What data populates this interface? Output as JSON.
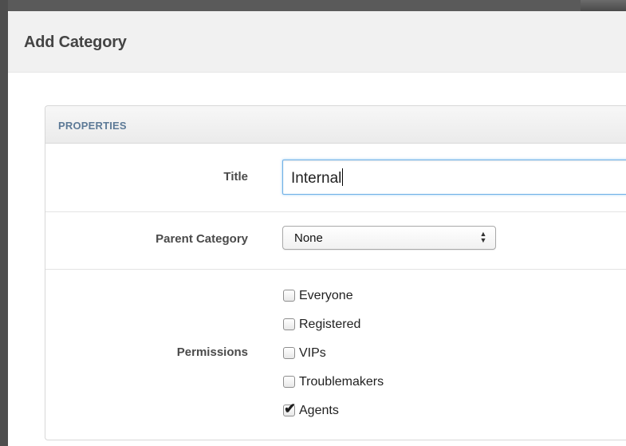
{
  "dialog": {
    "title": "Add Category"
  },
  "panel": {
    "header": "PROPERTIES"
  },
  "form": {
    "title_label": "Title",
    "title_value": "Internal",
    "parent_label": "Parent Category",
    "parent_value": "None",
    "permissions_label": "Permissions",
    "permissions": [
      {
        "label": "Everyone",
        "checked": false
      },
      {
        "label": "Registered",
        "checked": false
      },
      {
        "label": "VIPs",
        "checked": false
      },
      {
        "label": "Troublemakers",
        "checked": false
      },
      {
        "label": "Agents",
        "checked": true
      }
    ]
  },
  "icons": {
    "select_arrows": "up-down-chevron-icon",
    "checkbox_check": "checkmark-icon"
  },
  "colors": {
    "header_bg": "#f1f1f1",
    "panel_header_text": "#5d7a97",
    "input_focus_border": "#6fb0e6"
  }
}
